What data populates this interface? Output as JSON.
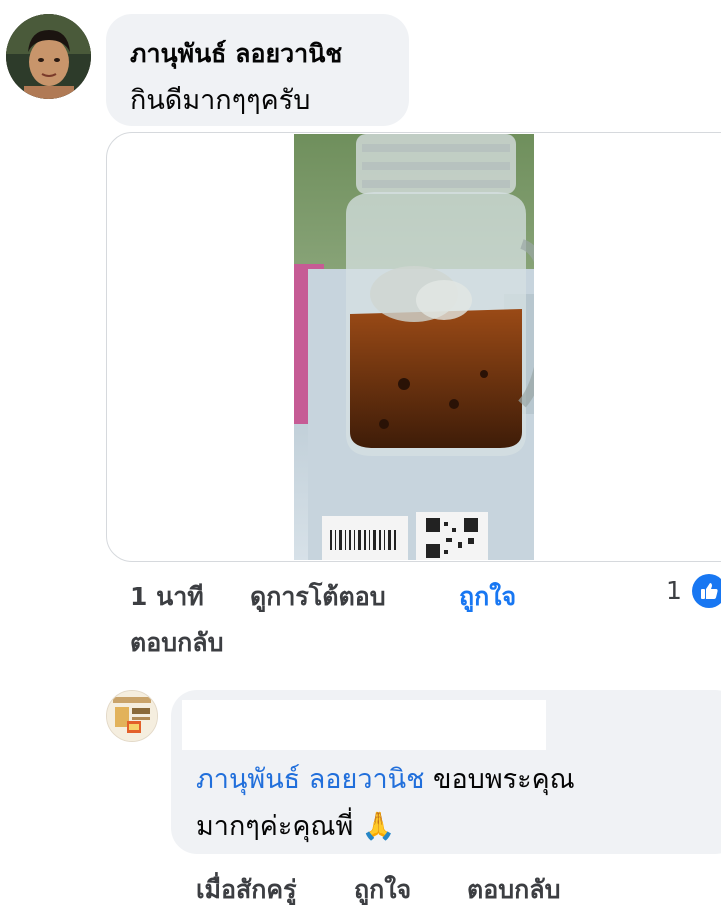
{
  "comment": {
    "author": "ภานุพันธ์ ลอยวานิช",
    "text": "กินดีมากๆๆครับ",
    "actions": {
      "time": "1 นาที",
      "see_reactions": "ดูการโต้ตอบ",
      "like": "ถูกใจ",
      "reply": "ตอบกลับ"
    },
    "like_count": "1"
  },
  "reply": {
    "mention": "ภานุพันธ์ ลอยวานิช",
    "text_line1_rest": " ขอบพระคุณ",
    "text_line2": "มากๆค่ะคุณพี่",
    "emoji": "🙏",
    "actions": {
      "time": "เมื่อสักครู่",
      "like": "ถูกใจ",
      "reply": "ตอบกลับ"
    }
  },
  "colors": {
    "bubble": "#f0f2f5",
    "link_blue": "#1877f2",
    "mention_blue": "#216fdb",
    "secondary_text": "#3c3e42"
  }
}
